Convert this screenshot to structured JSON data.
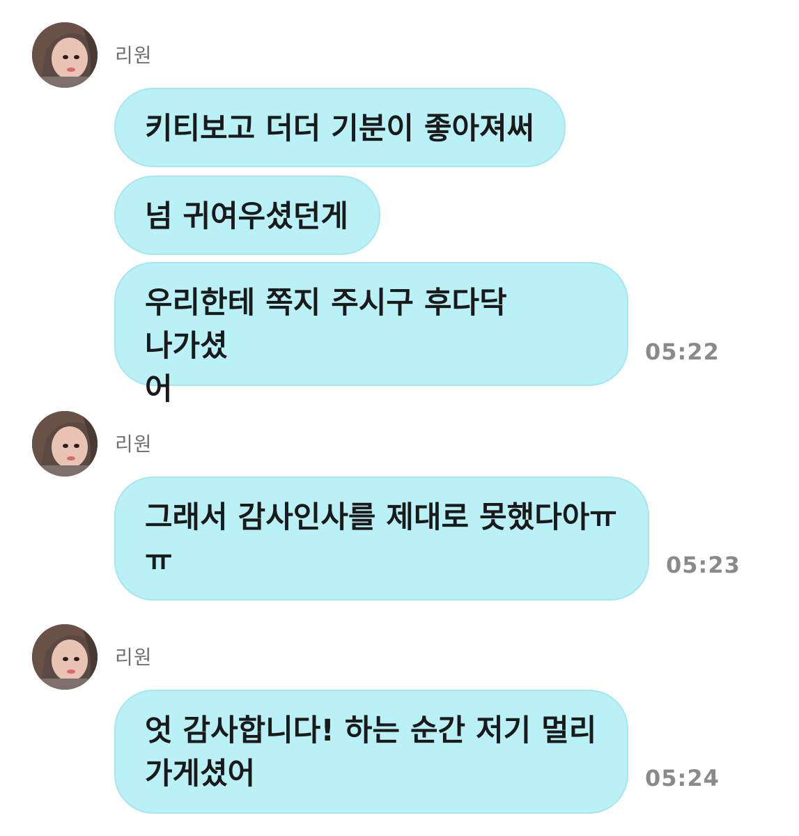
{
  "groups": [
    {
      "sender": "리원",
      "messages": [
        "키티보고 더더 기분이 좋아져써",
        "넘 귀여우셨던게",
        "우리한테 쪽지 주시구 후다닥 나가셨\n어"
      ],
      "time": "05:22"
    },
    {
      "sender": "리원",
      "messages": [
        "그래서 감사인사를 제대로 못했다아ㅠ\nㅠ"
      ],
      "time": "05:23"
    },
    {
      "sender": "리원",
      "messages": [
        "엇 감사합니다! 하는 순간 저기 멀리\n가게셨어"
      ],
      "time": "05:24"
    }
  ],
  "colors": {
    "bubble": "#b9f1f6",
    "bubble_border": "#a6e6ee",
    "text": "#1a1a1a",
    "sender": "#6f6f6f",
    "time": "#8a8a8a"
  }
}
